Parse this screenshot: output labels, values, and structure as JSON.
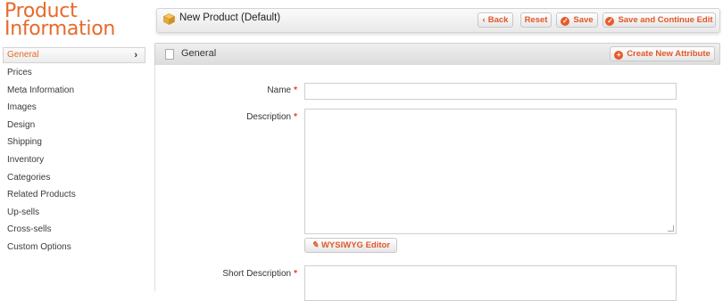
{
  "sidebar": {
    "title": "Product Information",
    "items": [
      {
        "label": "General",
        "active": true
      },
      {
        "label": "Prices"
      },
      {
        "label": "Meta Information"
      },
      {
        "label": "Images"
      },
      {
        "label": "Design"
      },
      {
        "label": "Shipping"
      },
      {
        "label": "Inventory"
      },
      {
        "label": "Categories"
      },
      {
        "label": "Related Products"
      },
      {
        "label": "Up-sells"
      },
      {
        "label": "Cross-sells"
      },
      {
        "label": "Custom Options"
      }
    ],
    "chevron": "›"
  },
  "toolbar": {
    "title": "New Product (Default)",
    "back_label": "Back",
    "reset_label": "Reset",
    "save_label": "Save",
    "save_continue_label": "Save and Continue Edit"
  },
  "panel": {
    "title": "General",
    "create_attribute_label": "Create New Attribute"
  },
  "form": {
    "name_label": "Name",
    "name_value": "",
    "description_label": "Description",
    "description_value": "",
    "wysiwyg_label": "WYSIWYG Editor",
    "short_description_label": "Short Description",
    "required_mark": "*"
  },
  "colors": {
    "accent": "#e66a2b",
    "required": "#e03c2a"
  },
  "icons": {
    "toolbar": "product-cube-icon",
    "back": "chevron-left-icon",
    "save": "check-circle-icon",
    "create": "plus-circle-icon",
    "panel": "document-icon",
    "wysiwyg": "pen-icon"
  }
}
